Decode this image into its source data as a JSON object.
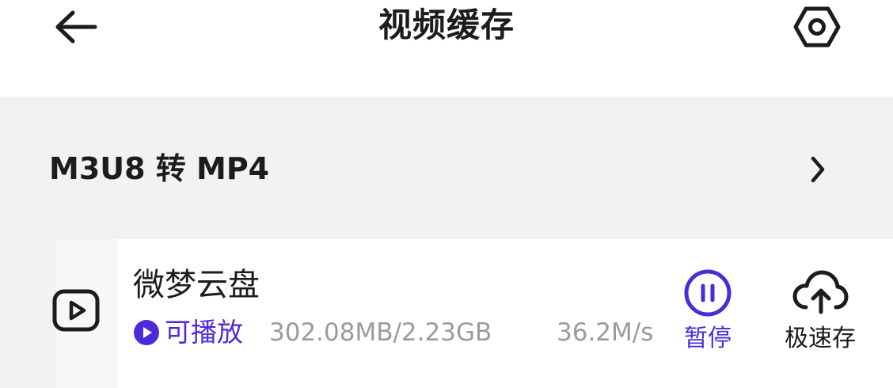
{
  "header": {
    "title": "视频缓存",
    "back_icon": "arrow-left-icon",
    "settings_icon": "hexagon-settings-icon"
  },
  "convert": {
    "label": "M3U8 转 MP4",
    "chevron_icon": "chevron-right-icon"
  },
  "download_item": {
    "title": "微梦云盘",
    "playable_label": "可播放",
    "size_progress": "302.08MB/2.23GB",
    "speed": "36.2M/s",
    "pause_label": "暂停",
    "fast_save_label": "极速存",
    "video_icon": "video-play-icon",
    "pause_icon": "pause-circle-icon",
    "cloud_icon": "cloud-upload-icon"
  },
  "colors": {
    "accent": "#4b2bd9",
    "text_primary": "#1c1c1c",
    "text_secondary": "#9b9b9b",
    "section_bg": "#f2f2f2",
    "page_bg": "#ffffff"
  }
}
